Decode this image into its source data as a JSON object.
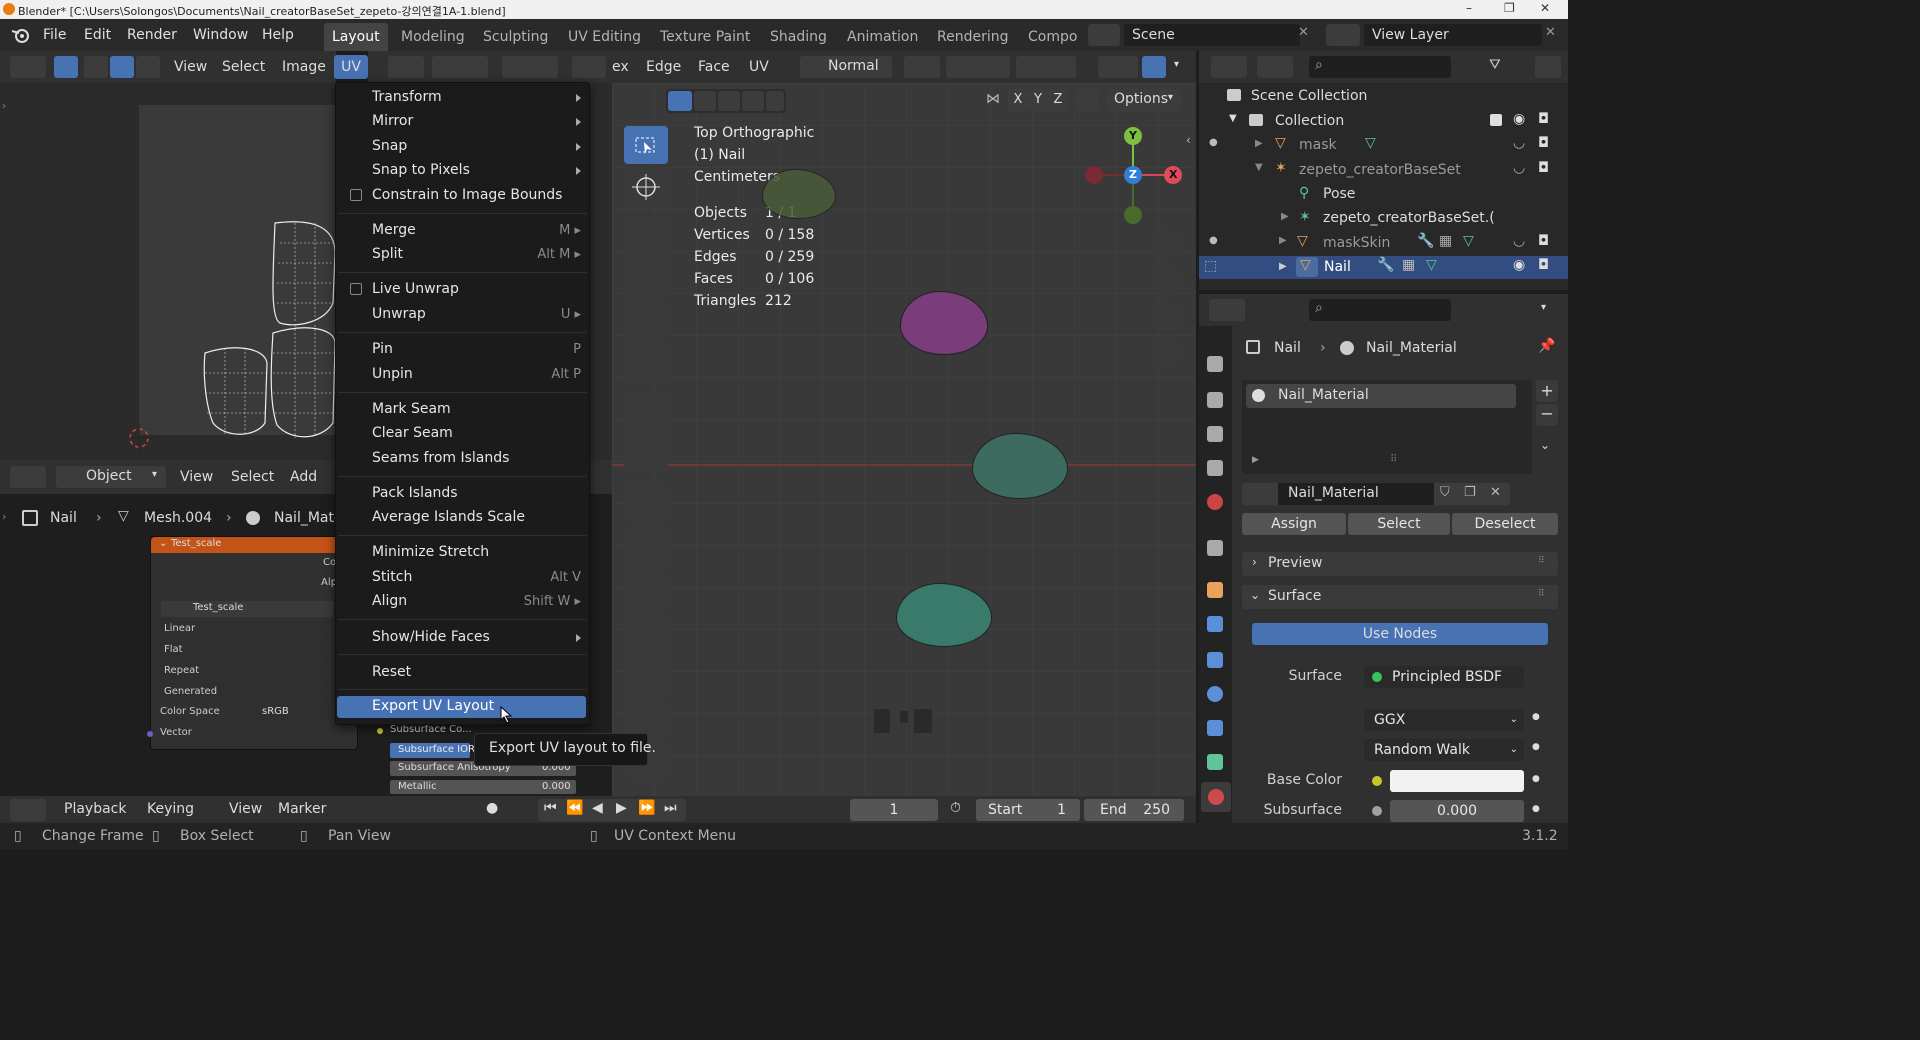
{
  "window": {
    "title": "Blender* [C:\\Users\\Solongos\\Documents\\Nail_creatorBaseSet_zepeto-강의연결1A-1.blend]",
    "controls": [
      "–",
      "❐",
      "✕"
    ]
  },
  "topbar": {
    "menus": [
      "File",
      "Edit",
      "Render",
      "Window",
      "Help"
    ],
    "workspaces": [
      "Layout",
      "Modeling",
      "Sculpting",
      "UV Editing",
      "Texture Paint",
      "Shading",
      "Animation",
      "Rendering",
      "Compo"
    ],
    "scene": "Scene",
    "view_layer": "View Layer"
  },
  "uv_editor": {
    "header": [
      "View",
      "Select",
      "Image",
      "UV"
    ]
  },
  "node_editor": {
    "mode": "Object",
    "header": [
      "View",
      "Select",
      "Add"
    ],
    "breadcrumb": [
      "Nail",
      "Mesh.004",
      "Nail_Mate"
    ],
    "node_title": "Test_scale",
    "node_image": "Test_scale",
    "partial_labels": [
      "Co",
      "Alp"
    ],
    "rows": [
      "Linear",
      "Flat",
      "Repeat",
      "Generated"
    ],
    "color_space_label": "Color Space",
    "color_space_value": "sRGB",
    "vector_label": "Vector",
    "bsdf_rows": [
      {
        "label": "Subsurface Co...",
        "value": ""
      },
      {
        "label": "Subsurface IOR",
        "value": ""
      },
      {
        "label": "Subsurface Anisotropy",
        "value": "0.000"
      },
      {
        "label": "Metallic",
        "value": "0.000"
      }
    ]
  },
  "uv_menu": {
    "items": [
      {
        "label": "Transform",
        "shortcut": "",
        "submenu": true
      },
      {
        "label": "Mirror",
        "shortcut": "",
        "submenu": true
      },
      {
        "label": "Snap",
        "shortcut": "",
        "submenu": true
      },
      {
        "label": "Snap to Pixels",
        "shortcut": "",
        "submenu": true
      },
      {
        "label": "Constrain to Image Bounds",
        "shortcut": "",
        "checkbox": true
      },
      {
        "label": "Merge",
        "shortcut": "M ▸"
      },
      {
        "label": "Split",
        "shortcut": "Alt M ▸"
      },
      {
        "label": "Live Unwrap",
        "shortcut": "",
        "checkbox": true
      },
      {
        "label": "Unwrap",
        "shortcut": "U ▸"
      },
      {
        "label": "Pin",
        "shortcut": "P"
      },
      {
        "label": "Unpin",
        "shortcut": "Alt P"
      },
      {
        "label": "Mark Seam",
        "shortcut": ""
      },
      {
        "label": "Clear Seam",
        "shortcut": ""
      },
      {
        "label": "Seams from Islands",
        "shortcut": ""
      },
      {
        "label": "Pack Islands",
        "shortcut": ""
      },
      {
        "label": "Average Islands Scale",
        "shortcut": ""
      },
      {
        "label": "Minimize Stretch",
        "shortcut": ""
      },
      {
        "label": "Stitch",
        "shortcut": "Alt V"
      },
      {
        "label": "Align",
        "shortcut": "Shift W ▸"
      },
      {
        "label": "Show/Hide Faces",
        "shortcut": "",
        "submenu": true
      },
      {
        "label": "Reset",
        "shortcut": ""
      },
      {
        "label": "Export UV Layout",
        "shortcut": "",
        "highlighted": true
      }
    ],
    "tooltip": "Export UV layout to file."
  },
  "viewport": {
    "header": [
      "ex",
      "Edge",
      "Face",
      "UV"
    ],
    "orientation": "Normal",
    "options": "Options",
    "axes_buttons": [
      "X",
      "Y",
      "Z"
    ],
    "info": {
      "view": "Top Orthographic",
      "object": "(1) Nail",
      "units": "Centimeters",
      "stats": [
        {
          "label": "Objects",
          "value": "1 / 1"
        },
        {
          "label": "Vertices",
          "value": "0 / 158"
        },
        {
          "label": "Edges",
          "value": "0 / 259"
        },
        {
          "label": "Faces",
          "value": "0 / 106"
        },
        {
          "label": "Triangles",
          "value": "212"
        }
      ]
    },
    "gizmo": {
      "x": "X",
      "y": "Y",
      "z": "Z"
    }
  },
  "outliner": {
    "root": "Scene Collection",
    "items": [
      {
        "label": "Collection",
        "level": 1
      },
      {
        "label": "mask",
        "level": 2
      },
      {
        "label": "zepeto_creatorBaseSet",
        "level": 2
      },
      {
        "label": "Pose",
        "level": 3
      },
      {
        "label": "zepeto_creatorBaseSet.(",
        "level": 3
      },
      {
        "label": "maskSkin",
        "level": 2
      },
      {
        "label": "Nail",
        "level": 2,
        "selected": true
      }
    ]
  },
  "properties": {
    "breadcrumb": [
      "Nail",
      "Nail_Material"
    ],
    "slot": "Nail_Material",
    "material": "Nail_Material",
    "buttons": [
      "Assign",
      "Select",
      "Deselect"
    ],
    "panels": [
      "Preview",
      "Surface"
    ],
    "use_nodes": "Use Nodes",
    "surface_label": "Surface",
    "surface_value": "Principled BSDF",
    "dist": "GGX",
    "sss": "Random Walk",
    "base_color_label": "Base Color",
    "subsurface_label": "Subsurface",
    "subsurface_value": "0.000"
  },
  "timeline": {
    "menus": [
      "Playback",
      "Keying",
      "View",
      "Marker"
    ],
    "frame": "1",
    "start_label": "Start",
    "start": "1",
    "end_label": "End",
    "end": "250"
  },
  "status": {
    "items": [
      "Change Frame",
      "Box Select",
      "Pan View",
      "UV Context Menu"
    ],
    "version": "3.1.2"
  }
}
